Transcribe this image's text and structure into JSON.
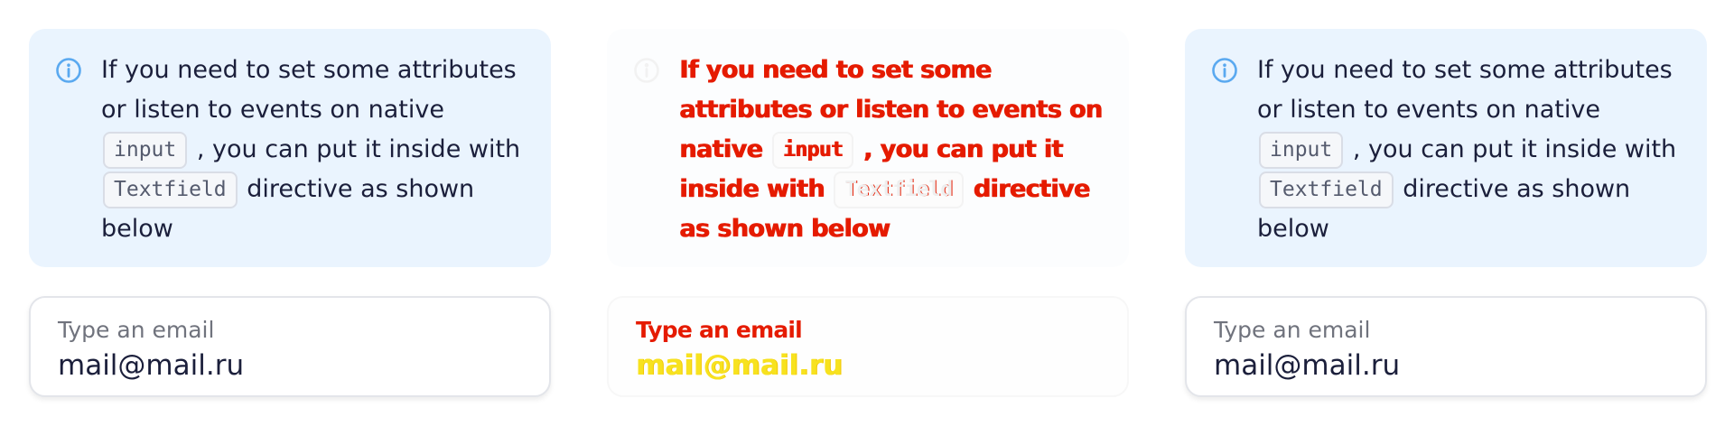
{
  "note": {
    "text_before": "If you need to set some attributes or listen to events on native",
    "code_input": "input",
    "text_middle": ", you can put it inside with",
    "code_textfield": "Textfield",
    "text_after": "directive as shown below",
    "icon": "info-icon"
  },
  "textfield": {
    "label": "Type an email",
    "value": "mail@mail.ru"
  },
  "colors": {
    "note_background": "#eaf4fe",
    "info_icon": "#5aa9f0",
    "text_primary": "#1b1f3b",
    "text_secondary": "#70737d",
    "glitch_red": "#e51b00",
    "glitch_yellow": "#f7e21f"
  }
}
